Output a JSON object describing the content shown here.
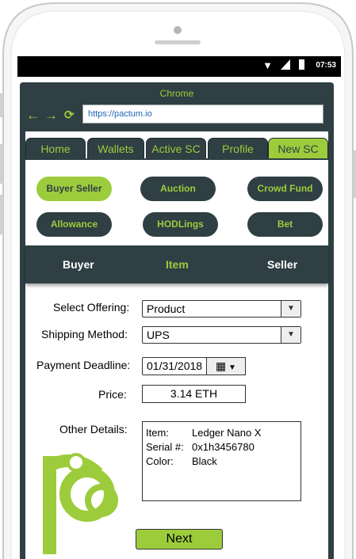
{
  "status_bar": {
    "time": "07:53"
  },
  "browser": {
    "title": "Chrome",
    "url": "https://pactum.io"
  },
  "tabs": [
    {
      "label": "Home",
      "active": false
    },
    {
      "label": "Wallets",
      "active": false
    },
    {
      "label": "Active SC",
      "active": false
    },
    {
      "label": "Profile",
      "active": false
    },
    {
      "label": "New SC",
      "active": true
    }
  ],
  "contract_types": [
    {
      "label": "Buyer Seller",
      "active": true
    },
    {
      "label": "Auction",
      "active": false
    },
    {
      "label": "Crowd Fund",
      "active": false
    },
    {
      "label": "Allowance",
      "active": false
    },
    {
      "label": "HODLings",
      "active": false
    },
    {
      "label": "Bet",
      "active": false
    }
  ],
  "parties": {
    "buyer": "Buyer",
    "item": "Item",
    "seller": "Seller"
  },
  "form": {
    "offering_label": "Select Offering:",
    "offering_value": "Product",
    "shipping_label": "Shipping Method:",
    "shipping_value": "UPS",
    "deadline_label": "Payment Deadline:",
    "deadline_value": "01/31/2018",
    "price_label": "Price:",
    "price_value": "3.14 ETH",
    "details_label": "Other Details:",
    "details": [
      {
        "key": "Item:",
        "value": "Ledger Nano X"
      },
      {
        "key": "Serial #:",
        "value": "0x1h3456780"
      },
      {
        "key": "Color:",
        "value": "Black"
      }
    ],
    "next_label": "Next"
  },
  "colors": {
    "accent": "#9ccc3c",
    "dark": "#2f3f44"
  }
}
